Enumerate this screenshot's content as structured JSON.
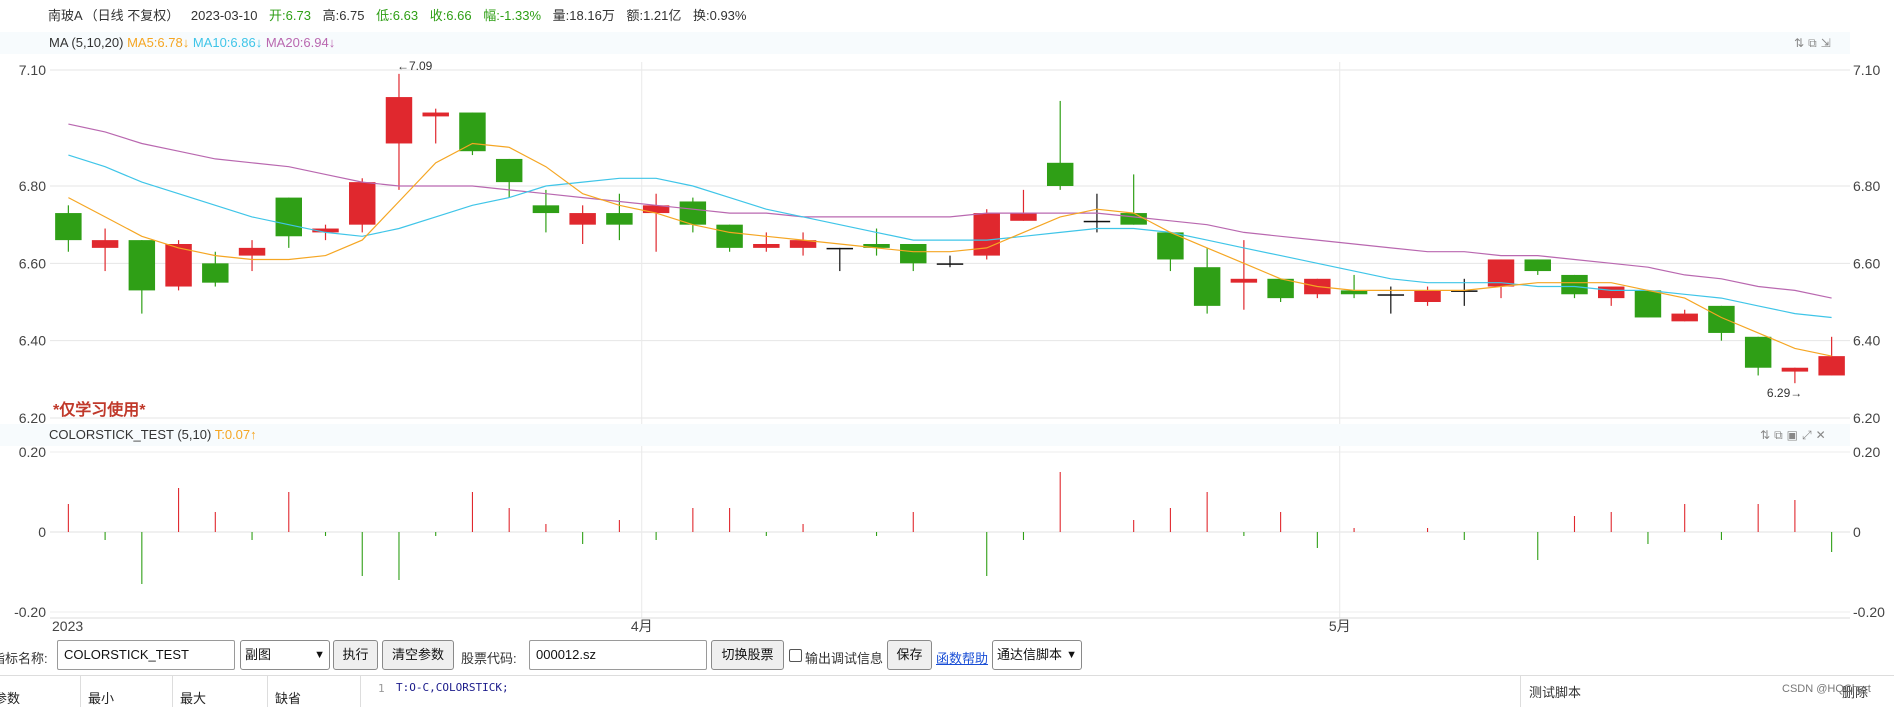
{
  "info": {
    "name": "南玻A",
    "period": "（日线 不复权）",
    "date": "2023-03-10",
    "open": "开:6.73",
    "high": "高:6.75",
    "low": "低:6.63",
    "close": "收:6.66",
    "change": "幅:-1.33%",
    "volume": "量:18.16万",
    "amount": "额:1.21亿",
    "turnover": "换:0.93%"
  },
  "ma_legend": {
    "label": "MA (5,10,20)",
    "ma5": "MA5:6.78↓",
    "ma10": "MA10:6.86↓",
    "ma20": "MA20:6.94↓"
  },
  "sub_legend": {
    "label": "COLORSTICK_TEST (5,10)",
    "value": "T:0.07↑"
  },
  "watermark": "*仅学习使用*",
  "annotations": {
    "high": "←7.09",
    "low": "6.29→"
  },
  "toolbar": {
    "name_label": "指标名称:",
    "name_value": "COLORSTICK_TEST",
    "type_value": "副图",
    "run": "执行",
    "clear": "清空参数",
    "code_label": "股票代码:",
    "code_value": "000012.sz",
    "switch": "切换股票",
    "debug_label": "输出调试信息",
    "save": "保存",
    "help": "函数帮助",
    "script_type": "通达信脚本"
  },
  "bottom": {
    "headers": [
      "参数",
      "最小",
      "最大",
      "缺省"
    ],
    "code_line_no": "1",
    "code": "T:O-C,COLORSTICK;",
    "test_label": "测试脚本",
    "delete": "删除",
    "credit": "CSDN @HQChart"
  },
  "colors": {
    "up": "#e0282e",
    "down": "#2f9f16",
    "ma5": "#f5a623",
    "ma10": "#3fc5e8",
    "ma20": "#b968b0"
  },
  "chart_data": [
    {
      "type": "candlestick",
      "main_axis": {
        "ylim": [
          6.2,
          7.1
        ],
        "ticks": [
          "7.10",
          "6.80",
          "6.60",
          "6.40",
          "6.20"
        ]
      },
      "x_labels": [
        "2023",
        "4月",
        "5月"
      ],
      "candles": [
        [
          6.73,
          6.66,
          6.75,
          6.63
        ],
        [
          6.64,
          6.66,
          6.69,
          6.58
        ],
        [
          6.66,
          6.53,
          6.66,
          6.47
        ],
        [
          6.54,
          6.65,
          6.66,
          6.53
        ],
        [
          6.6,
          6.55,
          6.63,
          6.54
        ],
        [
          6.62,
          6.64,
          6.66,
          6.58
        ],
        [
          6.77,
          6.67,
          6.77,
          6.64
        ],
        [
          6.68,
          6.69,
          6.7,
          6.66
        ],
        [
          6.7,
          6.81,
          6.82,
          6.68
        ],
        [
          6.91,
          7.03,
          7.09,
          6.79
        ],
        [
          6.98,
          6.99,
          7.0,
          6.91
        ],
        [
          6.99,
          6.89,
          6.99,
          6.88
        ],
        [
          6.87,
          6.81,
          6.87,
          6.77
        ],
        [
          6.75,
          6.73,
          6.79,
          6.68
        ],
        [
          6.7,
          6.73,
          6.75,
          6.65
        ],
        [
          6.73,
          6.7,
          6.78,
          6.66
        ],
        [
          6.73,
          6.75,
          6.78,
          6.63
        ],
        [
          6.76,
          6.7,
          6.77,
          6.68
        ],
        [
          6.7,
          6.64,
          6.7,
          6.63
        ],
        [
          6.64,
          6.65,
          6.68,
          6.63
        ],
        [
          6.64,
          6.66,
          6.68,
          6.62
        ],
        [
          6.64,
          6.64,
          6.64,
          6.58
        ],
        [
          6.65,
          6.64,
          6.69,
          6.62
        ],
        [
          6.65,
          6.6,
          6.65,
          6.58
        ],
        [
          6.6,
          6.6,
          6.62,
          6.59
        ],
        [
          6.62,
          6.73,
          6.74,
          6.61
        ],
        [
          6.71,
          6.73,
          6.79,
          6.71
        ],
        [
          6.86,
          6.8,
          7.02,
          6.79
        ],
        [
          6.71,
          6.71,
          6.78,
          6.68
        ],
        [
          6.73,
          6.7,
          6.83,
          6.7
        ],
        [
          6.68,
          6.61,
          6.68,
          6.58
        ],
        [
          6.59,
          6.49,
          6.64,
          6.47
        ],
        [
          6.55,
          6.56,
          6.66,
          6.48
        ],
        [
          6.56,
          6.51,
          6.56,
          6.5
        ],
        [
          6.52,
          6.56,
          6.56,
          6.51
        ],
        [
          6.53,
          6.52,
          6.57,
          6.51
        ],
        [
          6.52,
          6.52,
          6.54,
          6.47
        ],
        [
          6.5,
          6.53,
          6.54,
          6.49
        ],
        [
          6.53,
          6.53,
          6.56,
          6.49
        ],
        [
          6.54,
          6.61,
          6.61,
          6.51
        ],
        [
          6.61,
          6.58,
          6.61,
          6.57
        ],
        [
          6.57,
          6.52,
          6.57,
          6.51
        ],
        [
          6.51,
          6.54,
          6.54,
          6.49
        ],
        [
          6.53,
          6.46,
          6.53,
          6.46
        ],
        [
          6.45,
          6.47,
          6.48,
          6.45
        ],
        [
          6.49,
          6.42,
          6.49,
          6.4
        ],
        [
          6.41,
          6.33,
          6.41,
          6.31
        ],
        [
          6.32,
          6.33,
          6.33,
          6.29
        ],
        [
          6.31,
          6.36,
          6.41,
          6.31
        ]
      ],
      "ma5": [
        6.77,
        6.72,
        6.67,
        6.64,
        6.62,
        6.61,
        6.61,
        6.62,
        6.66,
        6.76,
        6.86,
        6.91,
        6.9,
        6.85,
        6.78,
        6.75,
        6.73,
        6.7,
        6.68,
        6.67,
        6.66,
        6.65,
        6.64,
        6.63,
        6.63,
        6.64,
        6.68,
        6.72,
        6.74,
        6.73,
        6.68,
        6.64,
        6.6,
        6.56,
        6.54,
        6.53,
        6.53,
        6.53,
        6.53,
        6.54,
        6.55,
        6.55,
        6.55,
        6.53,
        6.51,
        6.46,
        6.42,
        6.38,
        6.36
      ],
      "ma10": [
        6.88,
        6.85,
        6.81,
        6.78,
        6.75,
        6.72,
        6.7,
        6.68,
        6.67,
        6.69,
        6.72,
        6.75,
        6.77,
        6.8,
        6.81,
        6.82,
        6.82,
        6.8,
        6.77,
        6.74,
        6.72,
        6.7,
        6.68,
        6.66,
        6.66,
        6.66,
        6.67,
        6.68,
        6.69,
        6.69,
        6.68,
        6.66,
        6.64,
        6.62,
        6.6,
        6.58,
        6.56,
        6.55,
        6.55,
        6.55,
        6.54,
        6.54,
        6.53,
        6.53,
        6.52,
        6.51,
        6.49,
        6.47,
        6.46
      ],
      "ma20": [
        6.96,
        6.94,
        6.91,
        6.89,
        6.87,
        6.86,
        6.85,
        6.83,
        6.81,
        6.8,
        6.8,
        6.8,
        6.79,
        6.78,
        6.77,
        6.76,
        6.75,
        6.74,
        6.73,
        6.73,
        6.72,
        6.72,
        6.72,
        6.72,
        6.72,
        6.73,
        6.73,
        6.73,
        6.73,
        6.72,
        6.71,
        6.7,
        6.68,
        6.67,
        6.66,
        6.65,
        6.64,
        6.63,
        6.63,
        6.62,
        6.62,
        6.61,
        6.6,
        6.59,
        6.57,
        6.56,
        6.54,
        6.53,
        6.51
      ]
    },
    {
      "type": "colorstick",
      "series": "T",
      "sub_axis": {
        "ylim": [
          -0.2,
          0.2
        ],
        "ticks": [
          "0.20",
          "0",
          "-0.20"
        ]
      },
      "values": [
        0.07,
        -0.02,
        -0.13,
        0.11,
        0.05,
        -0.02,
        0.1,
        -0.01,
        -0.11,
        -0.12,
        -0.01,
        0.1,
        0.06,
        0.02,
        -0.03,
        0.03,
        -0.02,
        0.06,
        0.06,
        -0.01,
        0.02,
        0.0,
        -0.01,
        0.05,
        0.0,
        -0.11,
        -0.02,
        0.15,
        0.0,
        0.03,
        0.06,
        0.1,
        -0.01,
        0.05,
        -0.04,
        0.01,
        0.0,
        0.01,
        -0.02,
        0.0,
        -0.07,
        0.04,
        0.05,
        -0.03,
        0.07,
        -0.02,
        0.07,
        0.08,
        -0.05
      ]
    }
  ]
}
